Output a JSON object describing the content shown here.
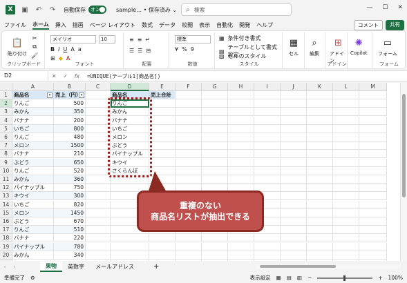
{
  "titlebar": {
    "logo": "X",
    "autosave_label": "自動保存",
    "autosave_state": "オン",
    "doc_title": "sample… • 保存済み ⌄",
    "search_placeholder": "検索"
  },
  "tabs": [
    "ファイル",
    "ホーム",
    "挿入",
    "描画",
    "ページ レイアウト",
    "数式",
    "データ",
    "校閲",
    "表示",
    "自動化",
    "開発",
    "ヘルプ"
  ],
  "comment_label": "コメント",
  "share_label": "共有",
  "ribbon": {
    "paste": "貼り付け",
    "clipboard": "クリップボード",
    "font_name": "メイリオ",
    "font_size": "10",
    "font": "フォント",
    "align": "配置",
    "numfmt": "標準",
    "number": "数値",
    "cond": "条件付き書式",
    "table_fmt": "テーブルとして書式設定",
    "cell_style": "セルのスタイル",
    "style": "スタイル",
    "cell": "セル",
    "edit": "編集",
    "addin": "アドイン",
    "addin_group": "アドイン",
    "copilot": "Copilot",
    "form": "フォーム",
    "form_group": "フォーム"
  },
  "formula_bar": {
    "name_box": "D2",
    "formula": "=UNIQUE(テーブル1[商品名])"
  },
  "columns": [
    "A",
    "B",
    "C",
    "D",
    "E",
    "F",
    "G",
    "H",
    "I",
    "J",
    "K",
    "L",
    "M"
  ],
  "rows": [
    "1",
    "2",
    "3",
    "4",
    "5",
    "6",
    "7",
    "8",
    "9",
    "10",
    "11",
    "12",
    "13",
    "14",
    "15",
    "16",
    "17",
    "18",
    "19",
    "20",
    "21"
  ],
  "table": {
    "headers": [
      "商品名",
      "売上（円）"
    ],
    "rows": [
      [
        "りんご",
        "500"
      ],
      [
        "みかん",
        "350"
      ],
      [
        "バナナ",
        "200"
      ],
      [
        "いちご",
        "800"
      ],
      [
        "りんご",
        "480"
      ],
      [
        "メロン",
        "1500"
      ],
      [
        "バナナ",
        "210"
      ],
      [
        "ぶどう",
        "650"
      ],
      [
        "りんご",
        "520"
      ],
      [
        "みかん",
        "360"
      ],
      [
        "パイナップル",
        "750"
      ],
      [
        "キウイ",
        "300"
      ],
      [
        "いちご",
        "820"
      ],
      [
        "メロン",
        "1450"
      ],
      [
        "ぶどう",
        "670"
      ],
      [
        "りんご",
        "510"
      ],
      [
        "バナナ",
        "220"
      ],
      [
        "パイナップル",
        "780"
      ],
      [
        "みかん",
        "340"
      ]
    ]
  },
  "unique": {
    "headers": [
      "商品名",
      "売上合計"
    ],
    "values": [
      "りんご",
      "みかん",
      "バナナ",
      "いちご",
      "メロン",
      "ぶどう",
      "パイナップル",
      "キウイ",
      "さくらんぼ"
    ]
  },
  "callout": {
    "line1": "重複のない",
    "line2": "商品名リストが抽出できる"
  },
  "sheets": [
    "果物",
    "英数字",
    "メールアドレス"
  ],
  "status": {
    "ready": "準備完了",
    "display_settings": "表示設定",
    "zoom": "100%"
  },
  "colors": {
    "accent": "#1d6f42",
    "callout": "#c0504d",
    "table_header": "#d9e8f6"
  }
}
